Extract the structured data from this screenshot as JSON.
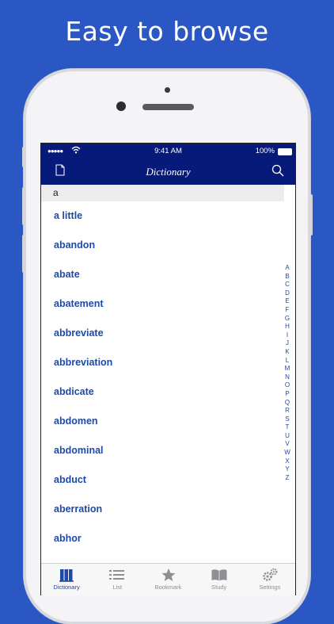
{
  "headline": "Easy to browse",
  "status_bar": {
    "time": "9:41 AM",
    "battery": "100%"
  },
  "nav": {
    "title": "Dictionary",
    "left_icon": "document-icon",
    "right_icon": "search-icon"
  },
  "section_header": "a",
  "words": [
    "a little",
    "abandon",
    "abate",
    "abatement",
    "abbreviate",
    "abbreviation",
    "abdicate",
    "abdomen",
    "abdominal",
    "abduct",
    "aberration",
    "abhor"
  ],
  "index_letters": [
    "A",
    "B",
    "C",
    "D",
    "E",
    "F",
    "G",
    "H",
    "I",
    "J",
    "K",
    "L",
    "M",
    "N",
    "O",
    "P",
    "Q",
    "R",
    "S",
    "T",
    "U",
    "V",
    "W",
    "X",
    "Y",
    "Z"
  ],
  "tabs": [
    {
      "label": "Dictionary",
      "icon": "books-icon",
      "active": true
    },
    {
      "label": "List",
      "icon": "list-icon",
      "active": false
    },
    {
      "label": "Bookmark",
      "icon": "star-icon",
      "active": false
    },
    {
      "label": "Study",
      "icon": "book-open-icon",
      "active": false
    },
    {
      "label": "Settings",
      "icon": "gears-icon",
      "active": false
    }
  ],
  "colors": {
    "background": "#2a57c4",
    "nav_bar": "#071a7a",
    "accent": "#1d4aa8",
    "tab_inactive": "#8e8e93"
  }
}
